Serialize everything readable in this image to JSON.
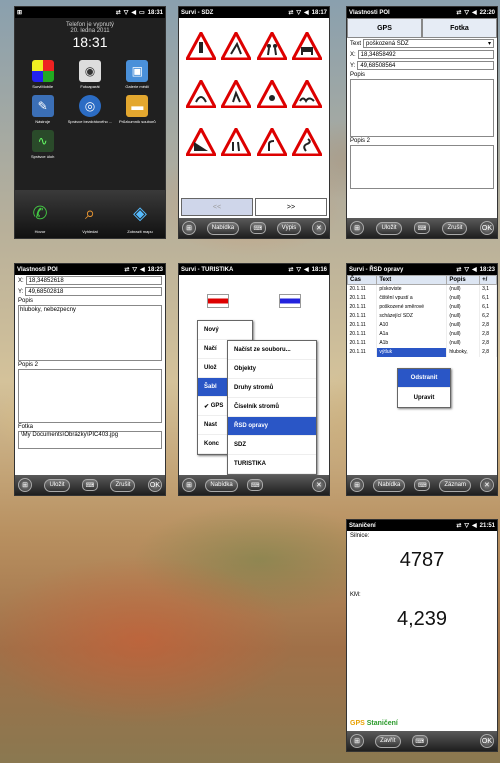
{
  "screen_home": {
    "status_time": "18:31",
    "phone_status": "Telefon je vypnutý",
    "date": "20. ledna 2011",
    "clock": "18:31",
    "apps": [
      {
        "label": "SurviMobile",
        "icon": "survimobile-icon"
      },
      {
        "label": "Fotoaparát",
        "icon": "camera-icon"
      },
      {
        "label": "Galerie médií",
        "icon": "media-gallery-icon"
      },
      {
        "label": "Nástroje",
        "icon": "tools-icon"
      },
      {
        "label": "Správce bezdrátového ...",
        "icon": "wireless-icon"
      },
      {
        "label": "Průzkumník souborů",
        "icon": "folder-icon"
      },
      {
        "label": "Správce úloh",
        "icon": "task-manager-icon"
      }
    ],
    "dock": [
      {
        "label": "Hovor",
        "icon": "phone-icon"
      },
      {
        "label": "Vyhledat",
        "icon": "search-icon"
      },
      {
        "label": "Zobrazit mapu",
        "icon": "map-icon"
      }
    ]
  },
  "screen_signs": {
    "title": "Survi - SDZ",
    "status_time": "18:17",
    "prev": "<<",
    "next": ">>",
    "menu": "Nabídka",
    "action": "Výpis"
  },
  "screen_poi1": {
    "title": "Vlastnosti POI",
    "status_time": "22:20",
    "tab_gps": "GPS",
    "tab_photo": "Fotka",
    "text_label": "Text",
    "text_value": "poškozená SDZ",
    "x_label": "X:",
    "x_value": "18,34858492",
    "y_label": "Y:",
    "y_value": "49,68508564",
    "popis": "Popis",
    "popis2": "Popis 2",
    "save": "Uložit",
    "cancel": "Zrušit",
    "ok": "OK"
  },
  "screen_poi2": {
    "title": "Vlastnosti POI",
    "status_time": "18:23",
    "x_label": "X:",
    "x_value": "18,34852618",
    "y_label": "Y:",
    "y_value": "49,68502818",
    "popis": "Popis",
    "popis_value": "hluboky, nebezpecny",
    "popis2": "Popis 2",
    "fotka": "Fotka",
    "fotka_value": "\\My Documents\\Obrázky\\PIC403.jpg",
    "save": "Uložit",
    "cancel": "Zrušit",
    "ok": "OK"
  },
  "screen_menu": {
    "title": "Survi - TURISTIKA",
    "status_time": "18:16",
    "menu_left": [
      "Nový",
      "Načí",
      "Ulož",
      "Šabl",
      "GPS",
      "Nast",
      "Konc"
    ],
    "menu_right": [
      "Načíst ze souboru...",
      "Objekty",
      "Druhy stromů",
      "Číselník stromů",
      "ŘSD opravy",
      "SDZ",
      "TURISTIKA"
    ],
    "selected": "ŘSD opravy",
    "menu": "Nabídka"
  },
  "screen_table": {
    "title": "Survi - ŘSD opravy",
    "status_time": "18:23",
    "headers": [
      "Čas",
      "Text",
      "Popis",
      "+/"
    ],
    "rows": [
      [
        "20.1.11",
        "pískoviste",
        "(null)",
        "3,1"
      ],
      [
        "20.1.11",
        "čištění vpustí a",
        "(null)",
        "6,1"
      ],
      [
        "20.1.11",
        "poškozené směrové",
        "(null)",
        "6,1"
      ],
      [
        "20.1.11",
        "scházející SDZ",
        "(null)",
        "6,2"
      ],
      [
        "20.1.11",
        "A10",
        "(null)",
        "2,8"
      ],
      [
        "20.1.11",
        "A1a",
        "(null)",
        "2,8"
      ],
      [
        "20.1.11",
        "A1b",
        "(null)",
        "2,8"
      ],
      [
        "20.1.11",
        "výtluk",
        "hluboky,",
        "2,8"
      ]
    ],
    "ctx_delete": "Odstranit",
    "ctx_edit": "Upravit",
    "menu": "Nabídka",
    "record": "Záznam"
  },
  "screen_gps": {
    "title": "Staničení",
    "status_time": "21:51",
    "silnice_label": "Silnice:",
    "silnice_value": "4787",
    "km_label": "KM:",
    "km_value": "4,239",
    "gps": "GPS",
    "stanice": "Staničení",
    "close": "Zavřít",
    "ok": "OK"
  }
}
